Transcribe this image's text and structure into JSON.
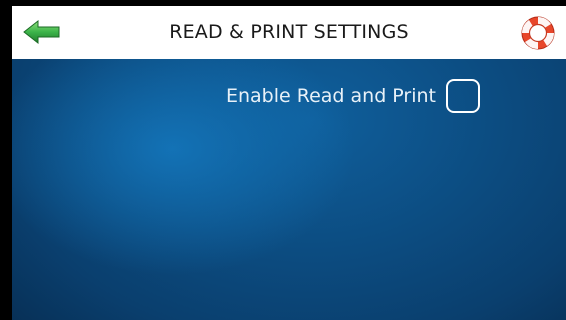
{
  "header": {
    "title": "READ & PRINT SETTINGS",
    "back_icon": "back-arrow-icon",
    "help_icon": "help-lifebuoy-icon"
  },
  "settings": {
    "enable_read_and_print": {
      "label": "Enable Read and Print",
      "checked": false
    }
  },
  "colors": {
    "header_bg": "#ffffff",
    "accent_green": "#3cb44a",
    "help_orange": "#e8462a",
    "content_blue": "#0f5f9c"
  }
}
